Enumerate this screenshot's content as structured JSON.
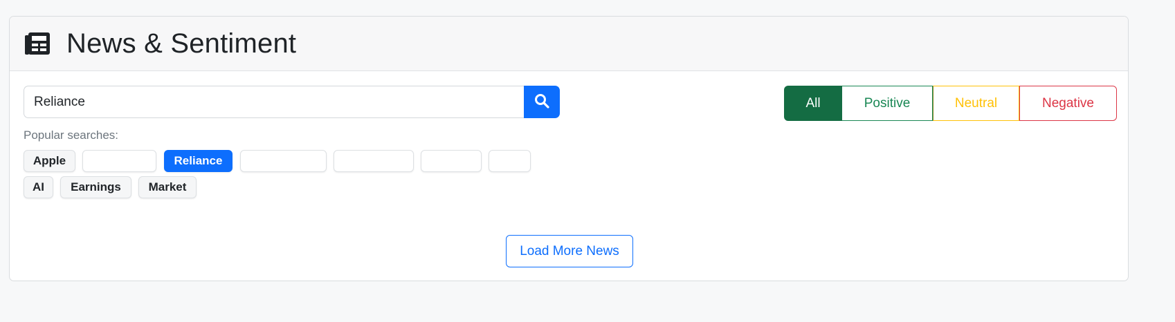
{
  "header": {
    "icon": "newspaper-icon",
    "title": "News & Sentiment"
  },
  "search": {
    "value": "Reliance",
    "button_icon": "search-icon"
  },
  "popular": {
    "label": "Popular searches:",
    "chips": [
      {
        "label": "Apple",
        "active": false
      },
      {
        "label": "",
        "active": false
      },
      {
        "label": "Reliance",
        "active": true
      },
      {
        "label": "",
        "active": false
      },
      {
        "label": "",
        "active": false
      },
      {
        "label": "",
        "active": false
      },
      {
        "label": "",
        "active": false
      },
      {
        "label": "AI",
        "active": false
      },
      {
        "label": "Earnings",
        "active": false
      },
      {
        "label": "Market",
        "active": false
      }
    ]
  },
  "filters": {
    "selected": "All",
    "options": [
      "All",
      "Positive",
      "Neutral",
      "Negative"
    ]
  },
  "load_more": {
    "label": "Load More News"
  },
  "colors": {
    "primary": "#0d6efd",
    "success_active": "#146c43",
    "success": "#198754",
    "warning": "#ffc107",
    "danger": "#dc3545"
  }
}
